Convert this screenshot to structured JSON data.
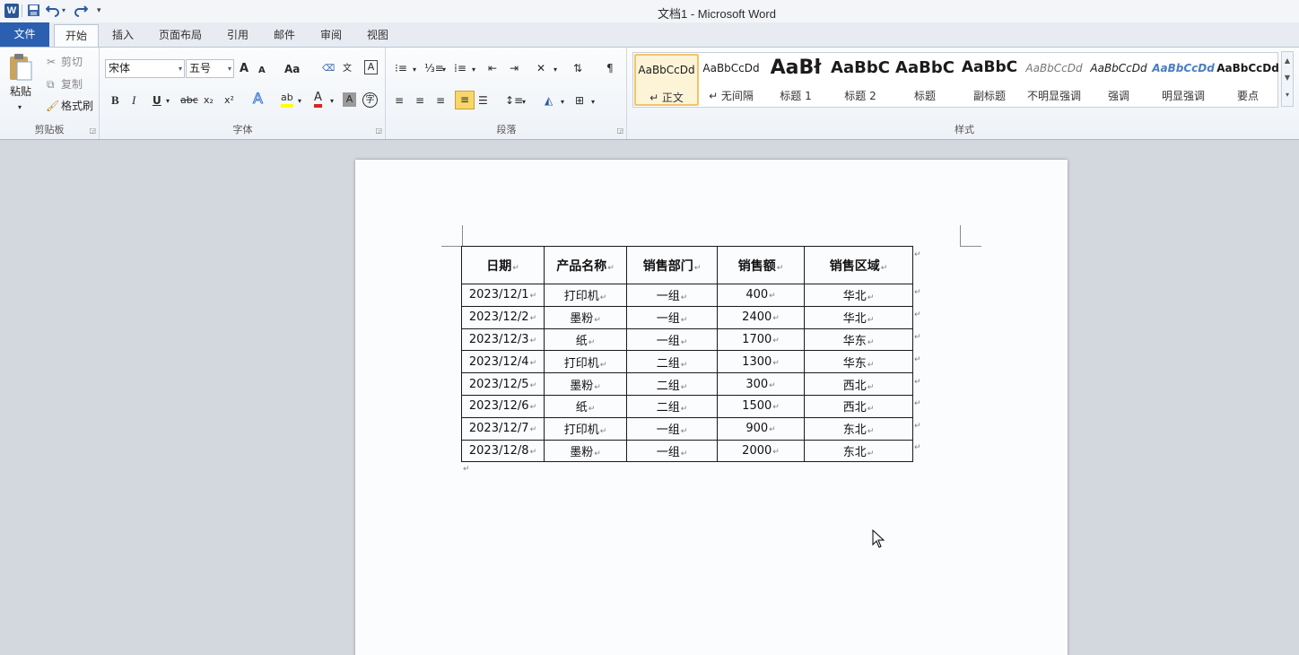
{
  "window": {
    "title": "文档1  -  Microsoft Word",
    "app_icon": "W"
  },
  "quick_access": {
    "save": "💾",
    "undo": "↶",
    "redo": "↷",
    "customize": "▾"
  },
  "tabs": [
    {
      "label": "文件"
    },
    {
      "label": "开始"
    },
    {
      "label": "插入"
    },
    {
      "label": "页面布局"
    },
    {
      "label": "引用"
    },
    {
      "label": "邮件"
    },
    {
      "label": "审阅"
    },
    {
      "label": "视图"
    }
  ],
  "clipboard": {
    "paste": "粘贴",
    "cut": "剪切",
    "copy": "复制",
    "format_painter": "格式刷",
    "label": "剪贴板"
  },
  "font": {
    "name": "宋体",
    "size": "五号",
    "label": "字体",
    "grow": "A",
    "shrink": "A",
    "change_case": "Aa",
    "bold": "B",
    "italic": "I",
    "underline": "U",
    "strike": "abc",
    "sub": "x₂",
    "sup": "x²",
    "text_effect": "A",
    "highlight": "ab",
    "font_color": "A",
    "char_shade": "A",
    "enclose": "字"
  },
  "paragraph": {
    "label": "段落"
  },
  "styles": {
    "label": "样式",
    "items": [
      {
        "preview": "AaBbCcDd",
        "name": "↵ 正文"
      },
      {
        "preview": "AaBbCcDd",
        "name": "↵ 无间隔"
      },
      {
        "preview": "AaBł",
        "name": "标题 1"
      },
      {
        "preview": "AaBbC",
        "name": "标题 2"
      },
      {
        "preview": "AaBbC",
        "name": "标题"
      },
      {
        "preview": "AaBbC",
        "name": "副标题"
      },
      {
        "preview": "AaBbCcDd",
        "name": "不明显强调"
      },
      {
        "preview": "AaBbCcDd",
        "name": "强调"
      },
      {
        "preview": "AaBbCcDd",
        "name": "明显强调"
      },
      {
        "preview": "AaBbCcDd",
        "name": "要点"
      }
    ]
  },
  "table": {
    "headers": [
      "日期",
      "产品名称",
      "销售部门",
      "销售额",
      "销售区域"
    ],
    "rows": [
      [
        "2023/12/1",
        "打印机",
        "一组",
        "400",
        "华北"
      ],
      [
        "2023/12/2",
        "墨粉",
        "一组",
        "2400",
        "华北"
      ],
      [
        "2023/12/3",
        "纸",
        "一组",
        "1700",
        "华东"
      ],
      [
        "2023/12/4",
        "打印机",
        "二组",
        "1300",
        "华东"
      ],
      [
        "2023/12/5",
        "墨粉",
        "二组",
        "300",
        "西北"
      ],
      [
        "2023/12/6",
        "纸",
        "二组",
        "1500",
        "西北"
      ],
      [
        "2023/12/7",
        "打印机",
        "一组",
        "900",
        "东北"
      ],
      [
        "2023/12/8",
        "墨粉",
        "一组",
        "2000",
        "东北"
      ]
    ],
    "cell_mark": "↵"
  },
  "colors": {
    "file_tab": "#2b5fb0",
    "highlight": "#ffff00",
    "font_red": "#e02020",
    "selected_style": "#f2c46a"
  }
}
